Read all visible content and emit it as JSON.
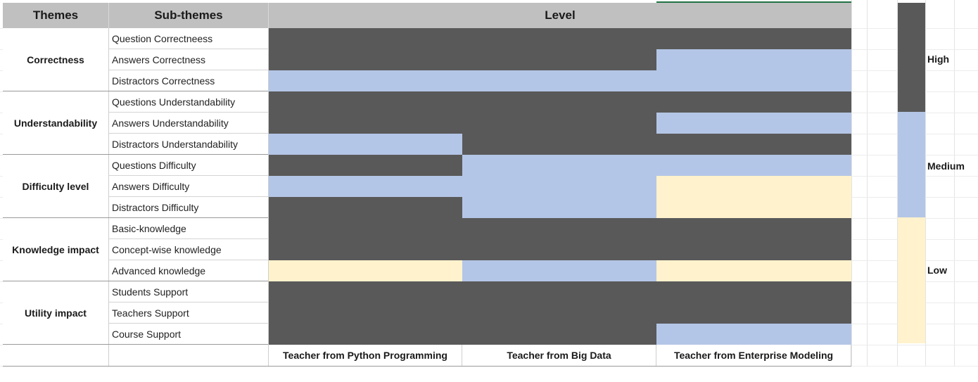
{
  "header": {
    "themes": "Themes",
    "subthemes": "Sub-themes",
    "level": "Level"
  },
  "themes": [
    {
      "name": "Correctness",
      "subthemes": [
        "Question Correctneess",
        "Answers Correctness",
        "Distractors Correctness"
      ]
    },
    {
      "name": "Understandability",
      "subthemes": [
        "Questions Understandability",
        "Answers Understandability",
        "Distractors Understandability"
      ]
    },
    {
      "name": "Difficulty level",
      "subthemes": [
        "Questions Difficulty",
        "Answers Difficulty",
        "Distractors Difficulty"
      ]
    },
    {
      "name": "Knowledge impact",
      "subthemes": [
        "Basic-knowledge",
        "Concept-wise knowledge",
        "Advanced knowledge"
      ]
    },
    {
      "name": "Utility impact",
      "subthemes": [
        "Students Support",
        "Teachers Support",
        "Course Support"
      ]
    }
  ],
  "teachers": [
    "Teacher from Python Programming",
    "Teacher from Big Data",
    "Teacher from Enterprise Modeling"
  ],
  "levels": [
    [
      "High",
      "High",
      "High"
    ],
    [
      "High",
      "High",
      "Medium"
    ],
    [
      "Medium",
      "Medium",
      "Medium"
    ],
    [
      "High",
      "High",
      "High"
    ],
    [
      "High",
      "High",
      "Medium"
    ],
    [
      "Medium",
      "High",
      "High"
    ],
    [
      "High",
      "Medium",
      "Medium"
    ],
    [
      "Medium",
      "Medium",
      "Low"
    ],
    [
      "High",
      "Medium",
      "Low"
    ],
    [
      "High",
      "High",
      "High"
    ],
    [
      "High",
      "High",
      "High"
    ],
    [
      "Low",
      "Medium",
      "Low"
    ],
    [
      "High",
      "High",
      "High"
    ],
    [
      "High",
      "High",
      "High"
    ],
    [
      "High",
      "High",
      "Medium"
    ]
  ],
  "legend": {
    "high": {
      "label": "High",
      "color": "#595959"
    },
    "medium": {
      "label": "Medium",
      "color": "#b4c6e7"
    },
    "low": {
      "label": "Low",
      "color": "#fff2cc"
    }
  }
}
